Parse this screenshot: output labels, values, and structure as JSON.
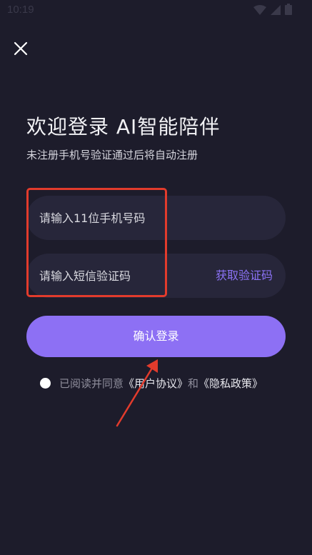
{
  "status_bar": {
    "time": "10:19",
    "icons": [
      "wifi-icon",
      "signal-icon",
      "battery-icon"
    ]
  },
  "header": {
    "close_icon": "close-icon"
  },
  "main": {
    "title": "欢迎登录  AI智能陪伴",
    "subtitle": "未注册手机号验证通过后将自动注册",
    "phone_placeholder": "请输入11位手机号码",
    "code_placeholder": "请输入短信验证码",
    "get_code_label": "获取验证码",
    "login_label": "确认登录"
  },
  "agreement": {
    "prefix": "已阅读并同意",
    "user_agreement": "《用户协议》",
    "and": "和",
    "privacy_policy": "《隐私政策》"
  },
  "colors": {
    "background": "#1d1c2b",
    "field_background": "#27263a",
    "accent": "#8d70f4",
    "annotation": "#e23b2c"
  }
}
